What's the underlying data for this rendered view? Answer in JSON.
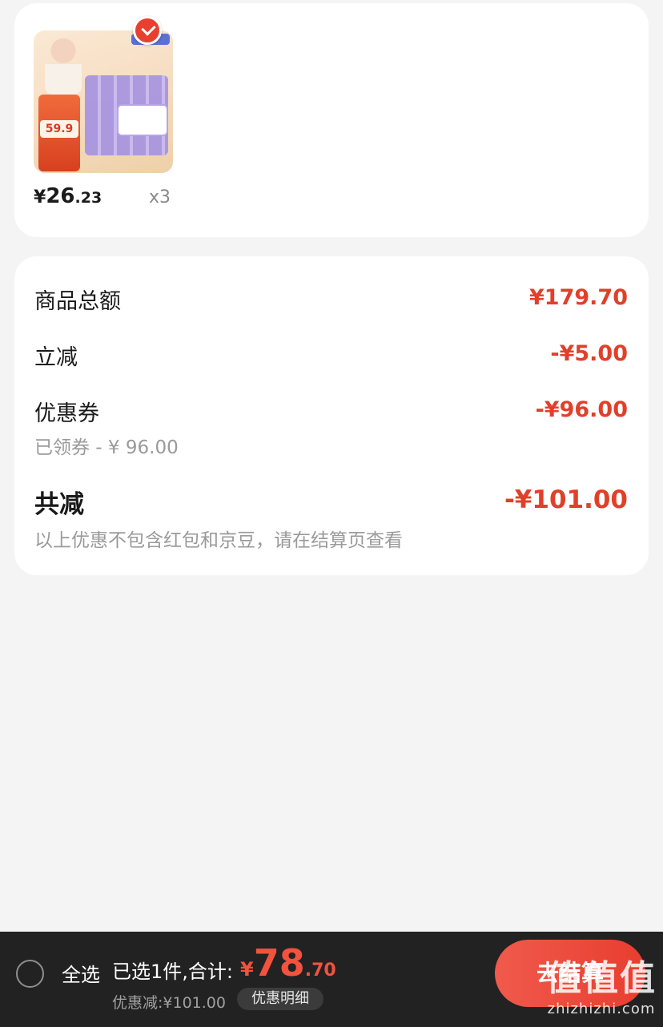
{
  "product": {
    "thumb_price_text": "59.9",
    "price_symbol": "¥",
    "price_integer": "26",
    "price_decimal": ".23",
    "quantity": "x3",
    "selected": true
  },
  "summary": {
    "rows": [
      {
        "label": "商品总额",
        "value": "¥179.70"
      },
      {
        "label": "立减",
        "value": "-¥5.00"
      },
      {
        "label": "优惠券",
        "value": "-¥96.00",
        "sub": "已领券 - ¥ 96.00"
      }
    ],
    "total_label": "共减",
    "total_value": "-¥101.00",
    "note": "以上优惠不包含红包和京豆，请在结算页查看"
  },
  "bottom_bar": {
    "select_all_label": "全选",
    "selected_text": "已选1件,合计:",
    "total_symbol": "¥",
    "total_integer": "78",
    "total_decimal": ".70",
    "discount_text": "优惠减:¥101.00",
    "detail_button": "优惠明细",
    "checkout_button": "去结算"
  },
  "watermark": {
    "logo_text": "值值值",
    "site": "zhizhizhi.com"
  },
  "colors": {
    "accent": "#e0402a",
    "bar_background": "#222222",
    "page_background": "#f4f4f4"
  }
}
